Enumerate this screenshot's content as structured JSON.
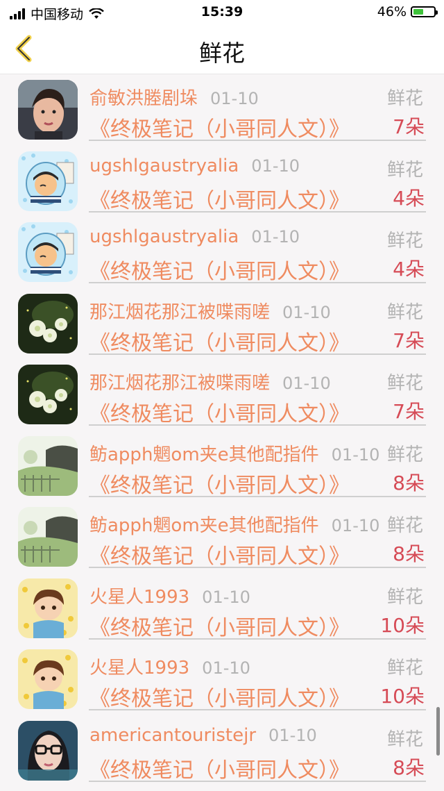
{
  "status_bar": {
    "carrier": "中国移动",
    "time": "15:39",
    "battery": "46%"
  },
  "header": {
    "title": "鲜花"
  },
  "items": [
    {
      "name": "俞敏洪塍剧垛",
      "date": "01-10",
      "label": "鲜花",
      "book": "《终极笔记（小哥同人文）》",
      "count": "7朵",
      "avatar": "portrait-woman"
    },
    {
      "name": "ugshlgaustryalia",
      "date": "01-10",
      "label": "鲜花",
      "book": "《终极笔记（小哥同人文）》",
      "count": "4朵",
      "avatar": "cartoon-jar"
    },
    {
      "name": "ugshlgaustryalia",
      "date": "01-10",
      "label": "鲜花",
      "book": "《终极笔记（小哥同人文）》",
      "count": "4朵",
      "avatar": "cartoon-jar"
    },
    {
      "name": "那江烟花那江被喋雨嗟",
      "date": "01-10",
      "label": "鲜花",
      "book": "《终极笔记（小哥同人文）》",
      "count": "7朵",
      "avatar": "white-flowers"
    },
    {
      "name": "那江烟花那江被喋雨嗟",
      "date": "01-10",
      "label": "鲜花",
      "book": "《终极笔记（小哥同人文）》",
      "count": "7朵",
      "avatar": "white-flowers"
    },
    {
      "name": "鲂apph魍om夹e其他配指件",
      "date": "01-10",
      "label": "鲜花",
      "book": "《终极笔记（小哥同人文）》",
      "count": "8朵",
      "avatar": "garden-scene"
    },
    {
      "name": "鲂apph魍om夹e其他配指件",
      "date": "01-10",
      "label": "鲜花",
      "book": "《终极笔记（小哥同人文）》",
      "count": "8朵",
      "avatar": "garden-scene"
    },
    {
      "name": "火星人1993",
      "date": "01-10",
      "label": "鲜花",
      "book": "《终极笔记（小哥同人文）》",
      "count": "10朵",
      "avatar": "cartoon-boy"
    },
    {
      "name": "火星人1993",
      "date": "01-10",
      "label": "鲜花",
      "book": "《终极笔记（小哥同人文）》",
      "count": "10朵",
      "avatar": "cartoon-boy"
    },
    {
      "name": "americantouristejr",
      "date": "01-10",
      "label": "鲜花",
      "book": "《终极笔记（小哥同人文）》",
      "count": "8朵",
      "avatar": "girl-glasses"
    }
  ],
  "colors": {
    "accent": "#ef8b60",
    "count": "#d64b56",
    "muted": "#b3b3b3"
  },
  "icons": [
    "signal-icon",
    "wifi-icon",
    "battery-icon",
    "back-chevron-icon"
  ]
}
